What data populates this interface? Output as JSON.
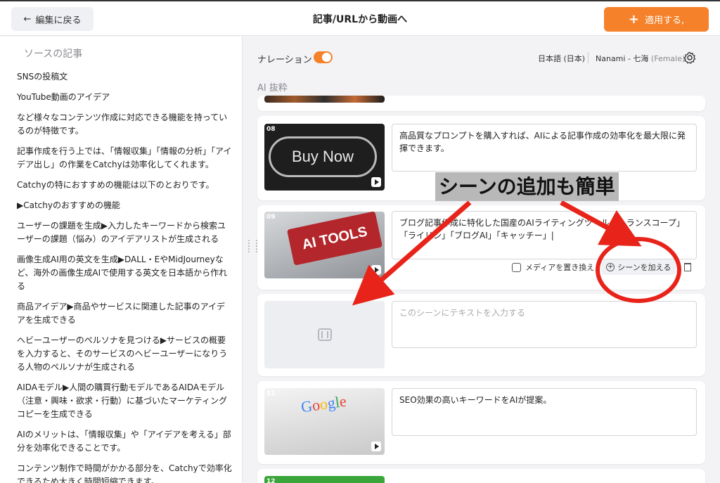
{
  "header": {
    "back_label": "編集に戻る",
    "title": "記事/URLから動画へ",
    "apply_label": "適用する,"
  },
  "source": {
    "heading": "ソースの記事",
    "paragraphs": [
      "SNSの投稿文",
      "YouTube動画のアイデア",
      "など様々なコンテンツ作成に対応できる機能を持っているのが特徴です。",
      "記事作成を行う上では、「情報収集」「情報の分析」「アイデア出し」の作業をCatchyは効率化してくれます。",
      "Catchyの特におすすめの機能は以下のとおりです。",
      "▶Catchyのおすすめの機能",
      "ユーザーの課題を生成▶入力したキーワードから検索ユーザーの課題（悩み）のアイデアリストが生成される",
      "画像生成AI用の英文を生成▶DALL・EやMidJourneyなど、海外の画像生成AIで使用する英文を日本語から作れる",
      "商品アイデア▶商品やサービスに関連した記事のアイデアを生成できる",
      "ヘビーユーザーのペルソナを見つける▶サービスの概要を入力すると、そのサービスのヘビーユーザーになりうる人物のペルソナが生成される",
      "AIDAモデル▶人間の購買行動モデルであるAIDAモデル（注意・興味・欲求・行動）に基づいたマーケティングコピーを生成できる",
      "AIのメリットは、「情報収集」や「アイデアを考える」部分を効率化できることです。",
      "コンテンツ制作で時間がかかる部分を、Catchyで効率化できるため大きく時間短縮できます。"
    ]
  },
  "narration": {
    "label": "ナレーション",
    "enabled": true,
    "language": "日本語 (日本)",
    "voice_name": "Nanami - 七海",
    "voice_gender": "(Female)"
  },
  "ai_section_label": "AI 抜粋",
  "scenes": [
    {
      "number": "08",
      "image_text": "Buy Now",
      "text": "高品質なプロンプトを購入すれば、AIによる記事作成の効率化を最大限に発揮できます。"
    },
    {
      "number": "09",
      "image_text": "AI TOOLS",
      "text": "ブログ記事作成に特化した国産のAIライティングツール「トランスコープ」「ライリン」「ブログAI」「キャッチー」|"
    },
    {
      "number": "",
      "image_text": "",
      "text": "このシーンにテキストを入力する"
    },
    {
      "number": "11",
      "image_text": "Google",
      "text": "SEO効果の高いキーワードをAIが提案。"
    },
    {
      "number": "12",
      "image_text": "",
      "text": ""
    }
  ],
  "scene_actions": {
    "replace_media_label": "メディアを置き換え",
    "add_scene_label": "シーンを加える"
  },
  "annotation": {
    "callout_text": "シーンの追加も簡単",
    "accent_color": "#e8231a"
  },
  "colors": {
    "brand_orange": "#f5822b"
  },
  "icons": [
    "back-arrow-icon",
    "plus-icon",
    "gear-icon",
    "play-icon",
    "media-icon",
    "plus-circle-icon",
    "trash-icon",
    "film-icon",
    "drag-handle-icon"
  ]
}
